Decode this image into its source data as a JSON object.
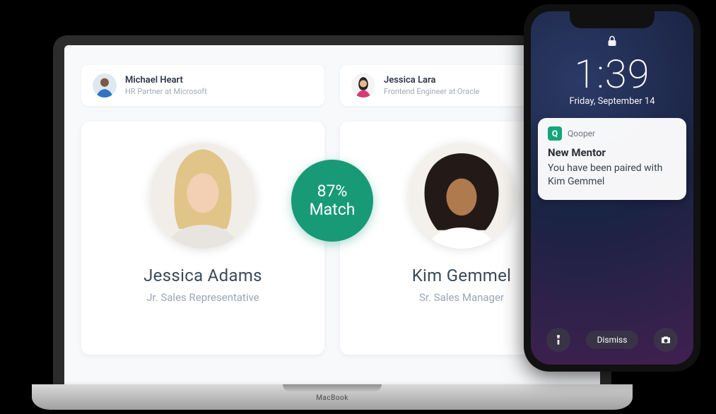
{
  "laptop": {
    "brand_label": "MacBook",
    "small_cards": [
      {
        "name": "Michael Heart",
        "subtitle": "HR Partner at Microsoft"
      },
      {
        "name": "Jessica Lara",
        "subtitle": "Frontend Engineer at Oracle"
      }
    ],
    "profiles": [
      {
        "name": "Jessica Adams",
        "title": "Jr. Sales Representative"
      },
      {
        "name": "Kim Gemmel",
        "title": "Sr. Sales Manager"
      }
    ],
    "match": {
      "percent": "87%",
      "label": "Match"
    }
  },
  "phone": {
    "time": "1:39",
    "date": "Friday, September 14",
    "notification": {
      "app_name": "Qooper",
      "title": "New Mentor",
      "body": "You have been paired with Kim Gemmel"
    },
    "dismiss_label": "Dismiss"
  }
}
